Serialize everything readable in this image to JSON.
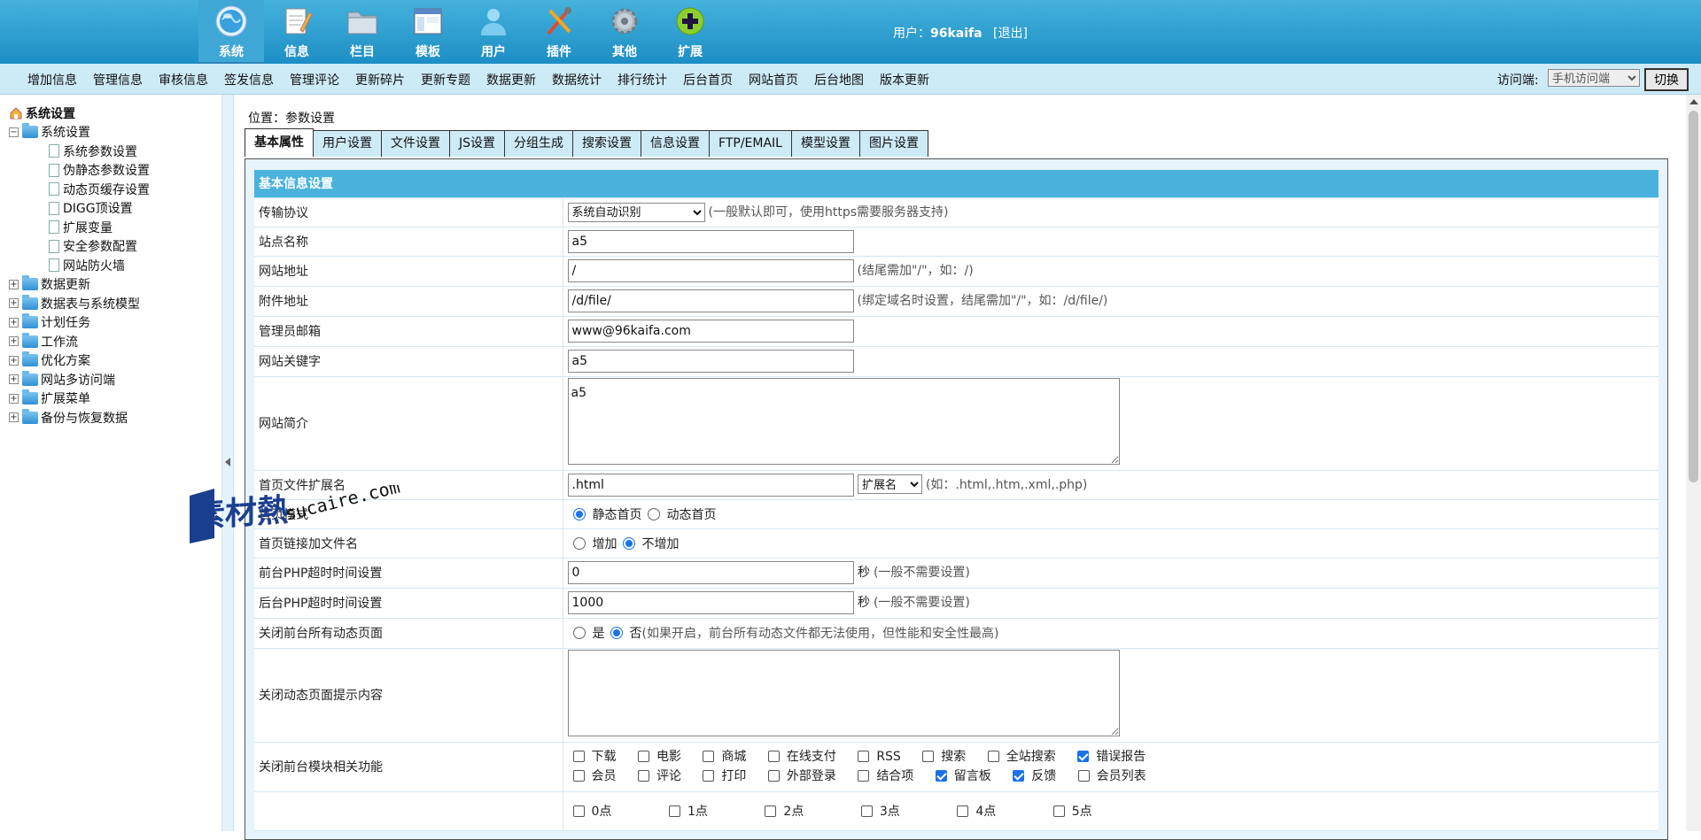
{
  "header": {
    "nav": [
      {
        "label": "系统",
        "icon": "globe-icon",
        "active": true
      },
      {
        "label": "信息",
        "icon": "notepad-icon"
      },
      {
        "label": "栏目",
        "icon": "folder-icon"
      },
      {
        "label": "模板",
        "icon": "window-icon"
      },
      {
        "label": "用户",
        "icon": "user-icon"
      },
      {
        "label": "插件",
        "icon": "tools-icon"
      },
      {
        "label": "其他",
        "icon": "gear-icon"
      },
      {
        "label": "扩展",
        "icon": "plus-icon"
      }
    ],
    "user_label": "用户：",
    "username": "96kaifa",
    "logout": "[退出]"
  },
  "subnav": {
    "items": [
      "增加信息",
      "管理信息",
      "审核信息",
      "签发信息",
      "管理评论",
      "更新碎片",
      "更新专题",
      "数据更新",
      "数据统计",
      "排行统计",
      "后台首页",
      "网站首页",
      "后台地图",
      "版本更新"
    ],
    "client_label": "访问端:",
    "client_value": "手机访问端",
    "switch_label": "切换"
  },
  "sidebar": {
    "root": "系统设置",
    "open_group": "系统设置",
    "children": [
      "系统参数设置",
      "伪静态参数设置",
      "动态页缓存设置",
      "DIGG顶设置",
      "扩展变量",
      "安全参数配置",
      "网站防火墙"
    ],
    "groups": [
      "数据更新",
      "数据表与系统模型",
      "计划任务",
      "工作流",
      "优化方案",
      "网站多访问端",
      "扩展菜单",
      "备份与恢复数据"
    ]
  },
  "location": {
    "label": "位置：",
    "value": "参数设置"
  },
  "tabs": [
    "基本属性",
    "用户设置",
    "文件设置",
    "JS设置",
    "分组生成",
    "搜索设置",
    "信息设置",
    "FTP/EMAIL",
    "模型设置",
    "图片设置"
  ],
  "form": {
    "section_title": "基本信息设置",
    "protocol": {
      "label": "传输协议",
      "value": "系统自动识别",
      "hint": "(一般默认即可，使用https需要服务器支持)"
    },
    "site_name": {
      "label": "站点名称",
      "value": "a5"
    },
    "site_url": {
      "label": "网站地址",
      "value": "/",
      "hint": "(结尾需加\"/\"，如：/)"
    },
    "attach_url": {
      "label": "附件地址",
      "value": "/d/file/",
      "hint": "(绑定域名时设置，结尾需加\"/\"，如：/d/file/)"
    },
    "admin_email": {
      "label": "管理员邮箱",
      "value": "www@96kaifa.com"
    },
    "keywords": {
      "label": "网站关键字",
      "value": "a5"
    },
    "intro": {
      "label": "网站简介",
      "value": "a5"
    },
    "index_ext": {
      "label": "首页文件扩展名",
      "value": ".html",
      "select": "扩展名",
      "hint": "(如：.html,.htm,.xml,.php)"
    },
    "index_mode": {
      "label": "首页模式",
      "opt1": "静态首页",
      "opt2": "动态首页"
    },
    "index_link": {
      "label": "首页链接加文件名",
      "opt1": "增加",
      "opt2": "不增加"
    },
    "php_front": {
      "label": "前台PHP超时时间设置",
      "value": "0",
      "unit": "秒",
      "hint": "(一般不需要设置)"
    },
    "php_back": {
      "label": "后台PHP超时时间设置",
      "value": "1000",
      "unit": "秒",
      "hint": "(一般不需要设置)"
    },
    "close_dynamic": {
      "label": "关闭前台所有动态页面",
      "opt1": "是",
      "opt2": "否",
      "hint": "(如果开启，前台所有动态文件都无法使用，但性能和安全性最高)"
    },
    "close_tip": {
      "label": "关闭动态页面提示内容",
      "value": ""
    },
    "close_modules": {
      "label": "关闭前台模块相关功能",
      "row1": [
        {
          "label": "下载",
          "checked": false
        },
        {
          "label": "电影",
          "checked": false
        },
        {
          "label": "商城",
          "checked": false
        },
        {
          "label": "在线支付",
          "checked": false
        },
        {
          "label": "RSS",
          "checked": false
        },
        {
          "label": "搜索",
          "checked": false
        },
        {
          "label": "全站搜索",
          "checked": false
        },
        {
          "label": "错误报告",
          "checked": true
        }
      ],
      "row2": [
        {
          "label": "会员",
          "checked": false
        },
        {
          "label": "评论",
          "checked": false
        },
        {
          "label": "打印",
          "checked": false
        },
        {
          "label": "外部登录",
          "checked": false
        },
        {
          "label": "结合项",
          "checked": false
        },
        {
          "label": "留言板",
          "checked": true
        },
        {
          "label": "反馈",
          "checked": true
        },
        {
          "label": "会员列表",
          "checked": false
        }
      ]
    },
    "hours": [
      "0点",
      "1点",
      "2点",
      "3点",
      "4点",
      "5点"
    ]
  },
  "watermark": {
    "text1": "素材熱",
    "text2": "sucaire.com"
  }
}
